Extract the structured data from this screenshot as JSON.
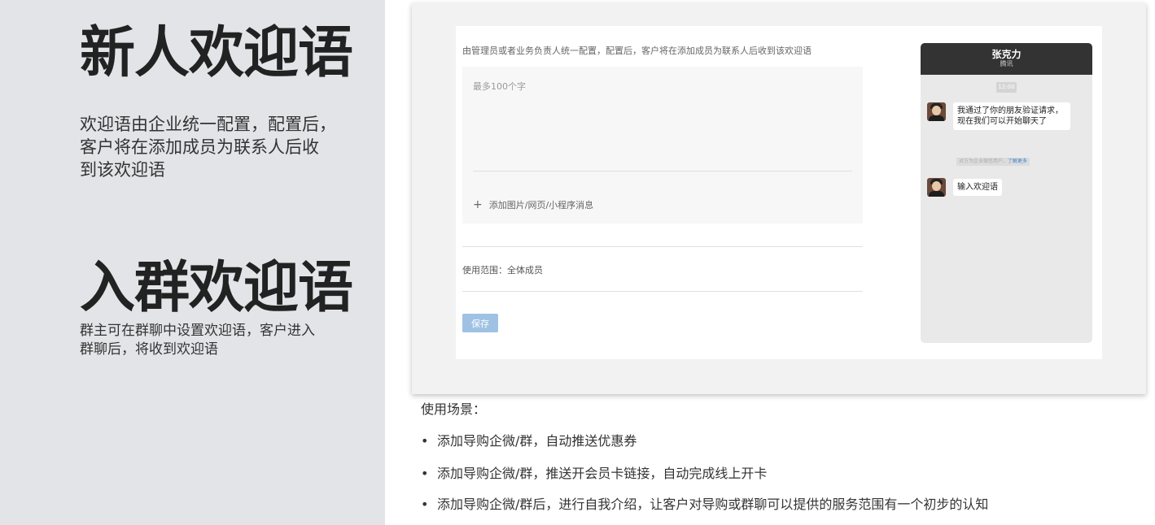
{
  "left": {
    "section1": {
      "title": "新人欢迎语",
      "lines": [
        "欢迎语由企业统一配置，配置后，",
        "客户将在添加成员为联系人后收",
        "到该欢迎语"
      ]
    },
    "section2": {
      "title": "入群欢迎语",
      "lines": [
        "群主可在群聊中设置欢迎语，客户进入",
        "群聊后，将收到欢迎语"
      ]
    }
  },
  "admin": {
    "hint": "由管理员或者业务负责人统一配置，配置后，客户将在添加成员为联系人后收到该欢迎语",
    "placeholder": "最多100个字",
    "add_attachment": "添加图片/网页/小程序消息",
    "scope": "使用范围：全体成员",
    "save": "保存"
  },
  "phone": {
    "name": "张克力",
    "company": "腾讯",
    "time": "12:00",
    "bubble1": "我通过了你的朋友验证请求，现在我们可以开始聊天了",
    "system_note": "对方为企业微信用户，",
    "system_link": "了解更多",
    "bubble2": "输入欢迎语"
  },
  "usage": {
    "title": "使用场景：",
    "items": [
      "添加导购企微/群，自动推送优惠券",
      "添加导购企微/群，推送开会员卡链接，自动完成线上开卡",
      "添加导购企微/群后，进行自我介绍，让客户对导购或群聊可以提供的服务范围有一个初步的认知"
    ]
  }
}
